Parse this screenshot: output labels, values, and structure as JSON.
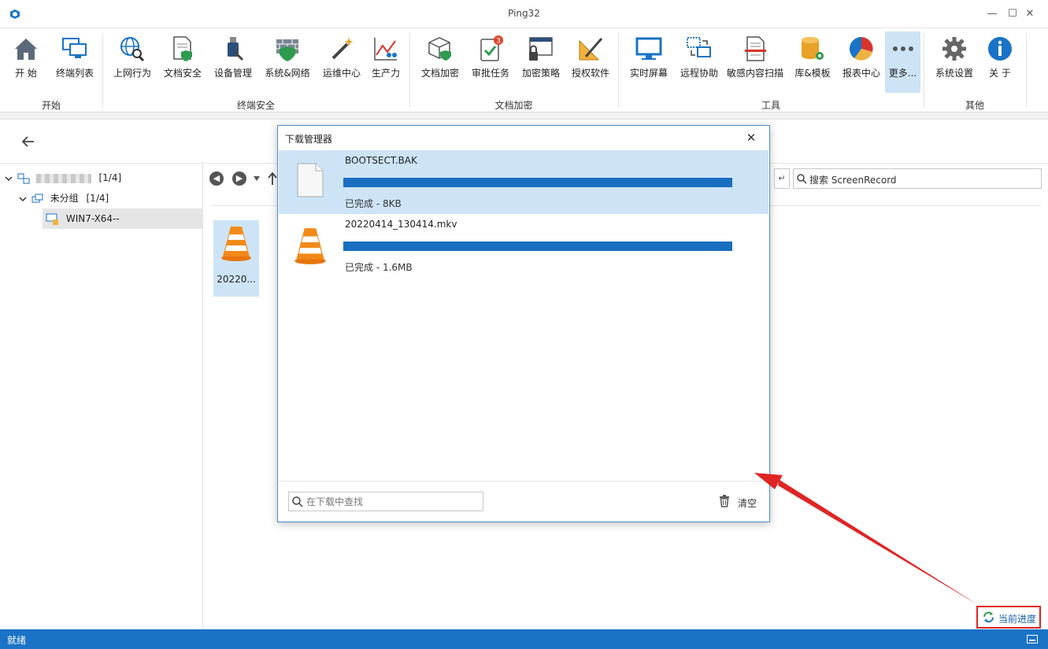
{
  "window": {
    "title": "Ping32",
    "minimize": "—",
    "maximize": "☐",
    "close": "✕"
  },
  "ribbon": {
    "groups": {
      "start": "开始",
      "endpoint_security": "终端安全",
      "doc_encryption": "文档加密",
      "tools": "工具",
      "other": "其他"
    },
    "buttons": {
      "start": "开 始",
      "endpoint_list": "终端列表",
      "web_behavior": "上网行为",
      "doc_security": "文档安全",
      "device_mgmt": "设备管理",
      "system_network": "系统&网络",
      "ops_center": "运维中心",
      "productivity": "生产力",
      "doc_encrypt": "文档加密",
      "approval": "审批任务",
      "approval_badge": "3",
      "encrypt_policy": "加密策略",
      "authorized_software": "授权软件",
      "realtime_screen": "实时屏幕",
      "remote_assist": "远程协助",
      "sensitive_scan": "敏感内容扫描",
      "library_template": "库&模板",
      "report_center": "报表中心",
      "more": "更多...",
      "settings": "系统设置",
      "about": "关 于"
    }
  },
  "tree": {
    "root_count": "[1/4]",
    "group_label": "未分组",
    "group_count": "[1/4]",
    "computer": "WIN7-X64--"
  },
  "browser": {
    "search_label": "搜索 ScreenRecord",
    "file_tile_label": "20220..."
  },
  "dialog": {
    "title": "下载管理器",
    "items": [
      {
        "name": "BOOTSECT.BAK",
        "status": "已完成 - 8KB",
        "progress": 1.0,
        "icon": "document-icon"
      },
      {
        "name": "20220414_130414.mkv",
        "status": "已完成 - 1.6MB",
        "progress": 1.0,
        "icon": "vlc-cone-icon"
      }
    ],
    "search_placeholder": "在下载中查找",
    "clear_label": "清空"
  },
  "status": {
    "ready": "就绪",
    "current_progress": "当前进度"
  },
  "colors": {
    "accent": "#1a73c6",
    "progress_fill": "#1a6fc0",
    "selection": "#cde4f7",
    "annotation": "#e02424",
    "badge": "#e0452b"
  }
}
